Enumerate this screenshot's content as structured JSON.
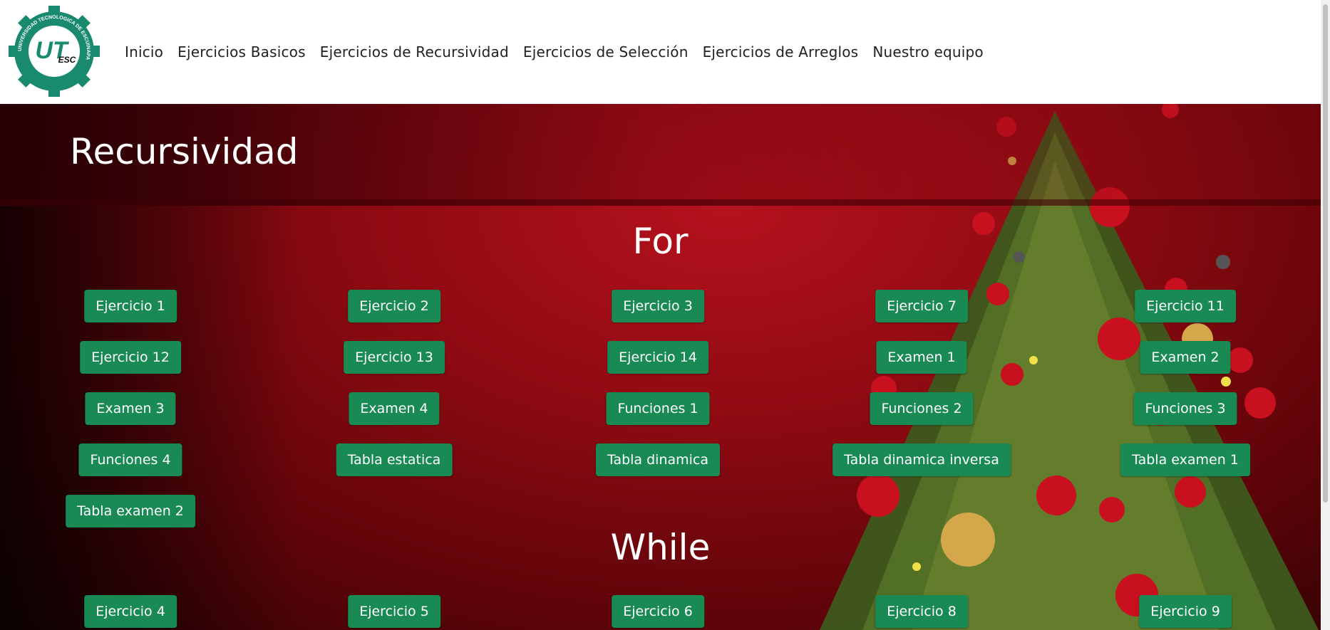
{
  "nav": {
    "items": [
      "Inicio",
      "Ejercicios Basicos",
      "Ejercicios de Recursividad",
      "Ejercicios de Selección",
      "Ejercicios de Arreglos",
      "Nuestro equipo"
    ]
  },
  "logo": {
    "ring_text": "UNIVERSIDAD TECNOLOGICA DE ESCUINAPA",
    "mark": "UT",
    "sub": "ESC"
  },
  "page_title": "Recursividad",
  "sections": {
    "for": {
      "title": "For",
      "buttons": [
        "Ejercicio 1",
        "Ejercicio 2",
        "Ejercicio 3",
        "Ejercicio 7",
        "Ejercicio 11",
        "Ejercicio 12",
        "Ejercicio 13",
        "Ejercicio 14",
        "Examen 1",
        "Examen 2",
        "Examen 3",
        "Examen 4",
        "Funciones 1",
        "Funciones 2",
        "Funciones 3",
        "Funciones 4",
        "Tabla estatica",
        "Tabla dinamica",
        "Tabla dinamica inversa",
        "Tabla examen 1",
        "Tabla examen 2"
      ]
    },
    "while": {
      "title": "While",
      "buttons": [
        "Ejercicio 4",
        "Ejercicio 5",
        "Ejercicio 6",
        "Ejercicio 8",
        "Ejercicio 9"
      ]
    }
  },
  "colors": {
    "button_bg": "#1a8a55",
    "hero_red": "#8f0a12",
    "logo_teal": "#1a8a6e"
  }
}
